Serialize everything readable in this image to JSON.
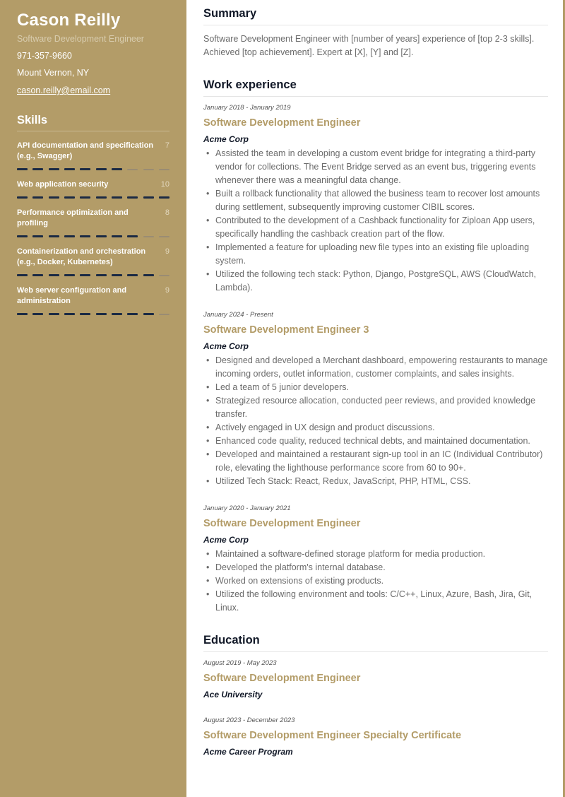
{
  "profile": {
    "name": "Cason Reilly",
    "role": "Software Development Engineer",
    "phone": "971-357-9660",
    "location": "Mount Vernon, NY",
    "email": "cason.reilly@email.com"
  },
  "skills": {
    "heading": "Skills",
    "max_rating": 10,
    "items": [
      {
        "name": "API documentation and specification (e.g., Swagger)",
        "rating": 7
      },
      {
        "name": "Web application security",
        "rating": 10
      },
      {
        "name": "Performance optimization and profiling",
        "rating": 8
      },
      {
        "name": "Containerization and orchestration (e.g., Docker, Kubernetes)",
        "rating": 9
      },
      {
        "name": "Web server configuration and administration",
        "rating": 9
      }
    ]
  },
  "summary": {
    "heading": "Summary",
    "text": "Software Development Engineer with [number of years] experience of [top 2-3 skills]. Achieved [top achievement]. Expert at [X], [Y] and [Z]."
  },
  "work": {
    "heading": "Work experience",
    "entries": [
      {
        "date": "January 2018 - January 2019",
        "title": "Software Development Engineer",
        "company": "Acme Corp",
        "bullets": [
          "Assisted the team in developing a custom event bridge for integrating a third-party vendor for collections. The Event Bridge served as an event bus, triggering events whenever there was a meaningful data change.",
          "Built a rollback functionality that allowed the business team to recover lost amounts during settlement, subsequently improving customer CIBIL scores.",
          "Contributed to the development of a Cashback functionality for Ziploan App users, specifically handling the cashback creation part of the flow.",
          "Implemented a feature for uploading new file types into an existing file uploading system.",
          "Utilized the following tech stack: Python, Django, PostgreSQL, AWS (CloudWatch, Lambda)."
        ]
      },
      {
        "date": "January 2024 - Present",
        "title": "Software Development Engineer 3",
        "company": "Acme Corp",
        "bullets": [
          "Designed and developed a Merchant dashboard, empowering restaurants to manage incoming orders, outlet information, customer complaints, and sales insights.",
          "Led a team of 5 junior developers.",
          "Strategized resource allocation, conducted peer reviews, and provided knowledge transfer.",
          "Actively engaged in UX design and product discussions.",
          "Enhanced code quality, reduced technical debts, and maintained documentation.",
          "Developed and maintained a restaurant sign-up tool in an IC (Individual Contributor) role, elevating the lighthouse performance score from 60 to 90+.",
          "Utilized Tech Stack: React, Redux, JavaScript, PHP, HTML, CSS."
        ]
      },
      {
        "date": "January 2020 - January 2021",
        "title": "Software Development Engineer",
        "company": "Acme Corp",
        "bullets": [
          "Maintained a software-defined storage platform for media production.",
          "Developed the platform's internal database.",
          "Worked on extensions of existing products.",
          "Utilized the following environment and tools: C/C++, Linux, Azure, Bash, Jira, Git, Linux."
        ]
      }
    ]
  },
  "education": {
    "heading": "Education",
    "entries": [
      {
        "date": "August 2019 - May 2023",
        "title": "Software Development Engineer",
        "institution": "Ace University"
      },
      {
        "date": "August 2023 - December 2023",
        "title": "Software Development Engineer Specialty Certificate",
        "institution": "Acme Career Program"
      }
    ]
  },
  "colors": {
    "accent": "#b39c68",
    "bar_filled": "#1b2a44",
    "bar_empty": "#9a8c73"
  }
}
